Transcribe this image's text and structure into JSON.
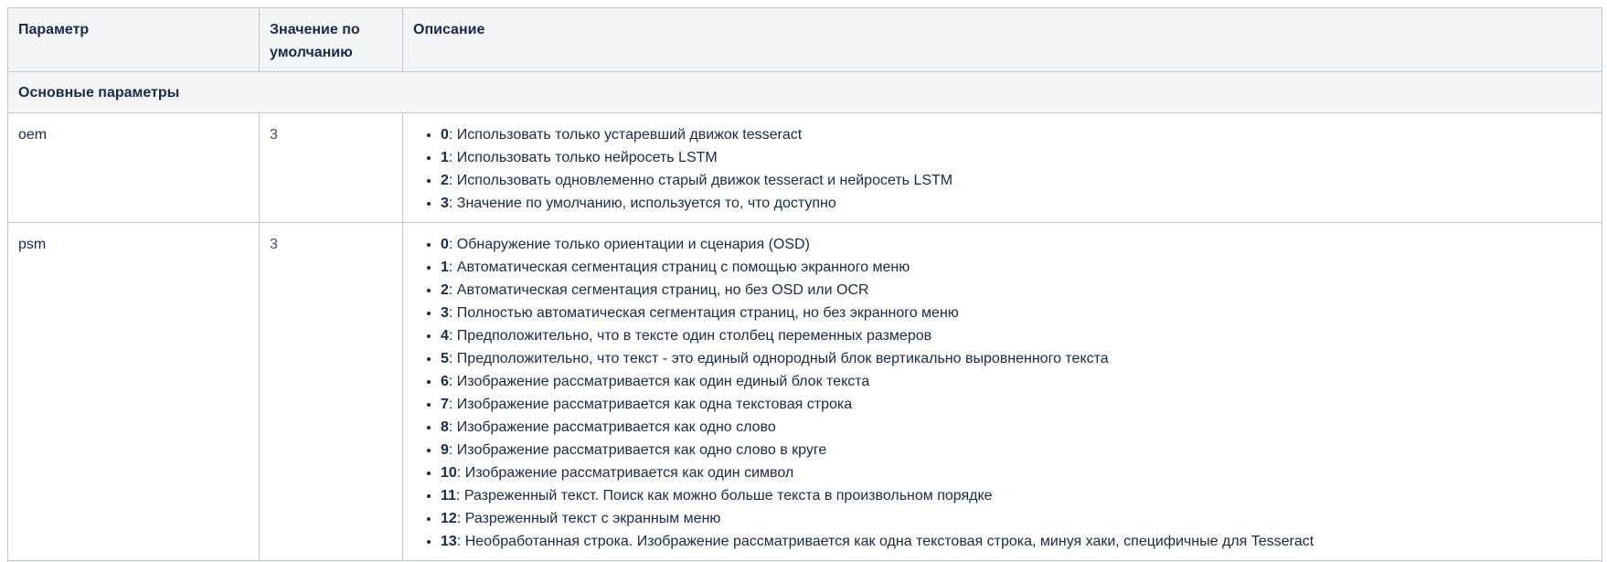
{
  "table": {
    "headers": {
      "param": "Параметр",
      "default": "Значение по умолчанию",
      "desc": "Описание"
    },
    "section_title": "Основные параметры",
    "rows": [
      {
        "param": "oem",
        "default": "3",
        "options": [
          {
            "code": "0",
            "text": ": Использовать только устаревший движок tesseract"
          },
          {
            "code": "1",
            "text": ": Использовать только нейросеть LSTM"
          },
          {
            "code": "2",
            "text": ": Использовать одновлеменно старый движок tesseract и нейросеть LSTM"
          },
          {
            "code": "3",
            "text": ": Значение по умолчанию, используется то, что доступно"
          }
        ]
      },
      {
        "param": "psm",
        "default": "3",
        "options": [
          {
            "code": "0",
            "text": ": Обнаружение только ориентации и сценария (OSD)"
          },
          {
            "code": "1",
            "text": ": Автоматическая сегментация страниц с помощью экранного меню"
          },
          {
            "code": "2",
            "text": ": Автоматическая сегментация страниц, но без OSD или OCR"
          },
          {
            "code": "3",
            "text": ": Полностью автоматическая сегментация страниц, но без экранного меню"
          },
          {
            "code": "4",
            "text": ": Предположительно, что в тексте один столбец переменных размеров"
          },
          {
            "code": "5",
            "text": ": Предположительно, что текст - это единый однородный блок вертикально выровненного текста"
          },
          {
            "code": "6",
            "text": ": Изображение рассматривается как один единый блок текста"
          },
          {
            "code": "7",
            "text": ": Изображение рассматривается как одна текстовая строка"
          },
          {
            "code": "8",
            "text": ": Изображение рассматривается как одно слово"
          },
          {
            "code": "9",
            "text": ": Изображение рассматривается как одно слово в круге"
          },
          {
            "code": "10",
            "text": ": Изображение рассматривается как один символ"
          },
          {
            "code": "11",
            "text": ": Разреженный текст. Поиск как можно больше текста в произвольном порядке"
          },
          {
            "code": "12",
            "text": ": Разреженный текст с экранным меню"
          },
          {
            "code": "13",
            "text": ": Необработанная строка. Изображение рассматривается как одна текстовая строка, минуя хаки, специфичные для Tesseract"
          }
        ]
      }
    ]
  }
}
